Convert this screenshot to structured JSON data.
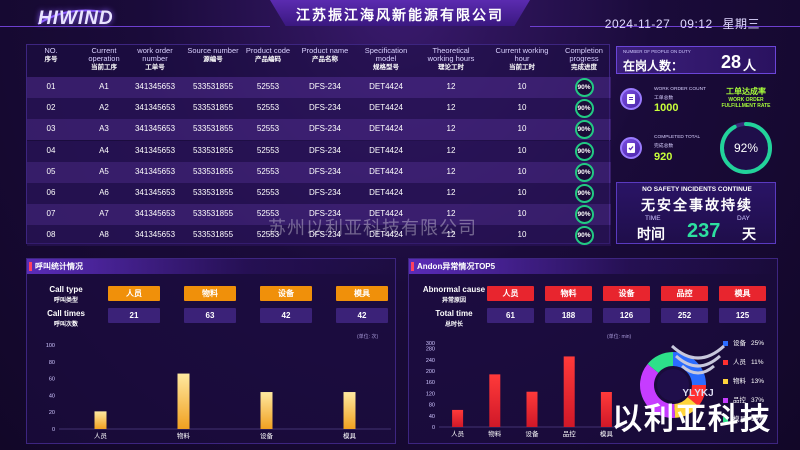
{
  "header": {
    "logo": "HIWIND",
    "company": "江苏振江海风新能源有限公司",
    "date": "2024-11-27",
    "time": "09:12",
    "weekday": "星期三"
  },
  "table": {
    "columns": [
      {
        "en": "NO.",
        "zh": "序号"
      },
      {
        "en": "Current operation",
        "zh": "当前工序"
      },
      {
        "en": "work order number",
        "zh": "工单号"
      },
      {
        "en": "Source number",
        "zh": "源编号"
      },
      {
        "en": "Product code",
        "zh": "产品编码"
      },
      {
        "en": "Product name",
        "zh": "产品名称"
      },
      {
        "en": "Specification model",
        "zh": "规格型号"
      },
      {
        "en": "Theoretical working hours",
        "zh": "理论工时"
      },
      {
        "en": "Current working hour",
        "zh": "当前工时"
      },
      {
        "en": "Completion progress",
        "zh": "完成进度"
      }
    ],
    "rows": [
      {
        "no": "01",
        "op": "A1",
        "wo": "341345653",
        "src": "533531855",
        "code": "52553",
        "name": "DFS-234",
        "spec": "DET4424",
        "theory": "12",
        "current": "10",
        "progress": "90%"
      },
      {
        "no": "02",
        "op": "A2",
        "wo": "341345653",
        "src": "533531855",
        "code": "52553",
        "name": "DFS-234",
        "spec": "DET4424",
        "theory": "12",
        "current": "10",
        "progress": "90%"
      },
      {
        "no": "03",
        "op": "A3",
        "wo": "341345653",
        "src": "533531855",
        "code": "52553",
        "name": "DFS-234",
        "spec": "DET4424",
        "theory": "12",
        "current": "10",
        "progress": "90%"
      },
      {
        "no": "04",
        "op": "A4",
        "wo": "341345653",
        "src": "533531855",
        "code": "52553",
        "name": "DFS-234",
        "spec": "DET4424",
        "theory": "12",
        "current": "10",
        "progress": "90%"
      },
      {
        "no": "05",
        "op": "A5",
        "wo": "341345653",
        "src": "533531855",
        "code": "52553",
        "name": "DFS-234",
        "spec": "DET4424",
        "theory": "12",
        "current": "10",
        "progress": "90%"
      },
      {
        "no": "06",
        "op": "A6",
        "wo": "341345653",
        "src": "533531855",
        "code": "52553",
        "name": "DFS-234",
        "spec": "DET4424",
        "theory": "12",
        "current": "10",
        "progress": "90%"
      },
      {
        "no": "07",
        "op": "A7",
        "wo": "341345653",
        "src": "533531855",
        "code": "52553",
        "name": "DFS-234",
        "spec": "DET4424",
        "theory": "12",
        "current": "10",
        "progress": "90%"
      },
      {
        "no": "08",
        "op": "A8",
        "wo": "341345653",
        "src": "533531855",
        "code": "52553",
        "name": "DFS-234",
        "spec": "DET4424",
        "theory": "12",
        "current": "10",
        "progress": "90%"
      }
    ]
  },
  "stats": {
    "duty_en": "NUMBER OF PEOPLE ON DUTY",
    "duty_zh": "在岗人数：",
    "duty_value": "28",
    "duty_unit": "人",
    "wo_count_en": "WORK ORDER COUNT",
    "wo_count_zh": "工单总数",
    "wo_count_value": "1000",
    "completed_en": "COMPLETED TOTAL",
    "completed_zh": "完成总数",
    "completed_value": "920",
    "rate_zh": "工单达成率",
    "rate_en": "WORK ORDER FULFILLMENT RATE",
    "rate_value": "92%",
    "rate_fraction": 0.92,
    "safety_en": "NO SAFETY INCIDENTS CONTINUE",
    "safety_zh": "无安全事故持续",
    "time_en": "TIME",
    "day_en": "DAY",
    "time_zh": "时间",
    "days_value": "237",
    "day_zh": "天"
  },
  "call_panel": {
    "title": "呼叫统计情况",
    "type_en": "Call type",
    "type_zh": "呼叫类型",
    "times_en": "Call times",
    "times_zh": "呼叫次数",
    "tag_color": "#f0900a",
    "categories": [
      "人员",
      "物料",
      "设备",
      "模具"
    ],
    "values": [
      "21",
      "63",
      "42",
      "42"
    ],
    "unit": "(单位: 次)"
  },
  "andon_panel": {
    "title": "Andon异常情况TOP5",
    "cause_en": "Abnormal cause",
    "cause_zh": "异常原因",
    "total_en": "Total time",
    "total_zh": "总时长",
    "tag_color": "#e8252e",
    "categories": [
      "人员",
      "物料",
      "设备",
      "品控",
      "模具"
    ],
    "values": [
      "61",
      "188",
      "126",
      "252",
      "125"
    ],
    "unit": "(单位: min)",
    "legend": [
      {
        "label": "设备",
        "pct": "25%",
        "color": "#2b6cff"
      },
      {
        "label": "人员",
        "pct": "11%",
        "color": "#ff3030"
      },
      {
        "label": "物料",
        "pct": "13%",
        "color": "#ffd43b"
      },
      {
        "label": "品控",
        "pct": "37%",
        "color": "#c63cff"
      },
      {
        "label": "模具",
        "pct": "14%",
        "color": "#2de08a"
      }
    ]
  },
  "chart_data": [
    {
      "type": "bar",
      "title": "",
      "categories": [
        "人员",
        "物料",
        "设备",
        "模具"
      ],
      "values": [
        21,
        66,
        44,
        44
      ],
      "ylim": [
        0,
        100
      ],
      "yticks": [
        0,
        20,
        40,
        60,
        80,
        100
      ],
      "xlabel": "",
      "ylabel": "",
      "unit": "(单位: 次)",
      "grid": false,
      "color": "#ffd86a"
    },
    {
      "type": "bar",
      "title": "",
      "categories": [
        "人员",
        "物料",
        "设备",
        "品控",
        "模具"
      ],
      "values": [
        61,
        188,
        126,
        252,
        125
      ],
      "ylim": [
        0,
        300
      ],
      "yticks": [
        0,
        40,
        80,
        120,
        160,
        200,
        240,
        280,
        300
      ],
      "xlabel": "",
      "ylabel": "",
      "unit": "(单位: min)",
      "grid": false,
      "color": "#ff2a2a"
    },
    {
      "type": "pie",
      "labels": [
        "设备",
        "人员",
        "物料",
        "品控",
        "模具"
      ],
      "values": [
        25,
        11,
        13,
        37,
        14
      ],
      "colors": [
        "#2b6cff",
        "#ff3030",
        "#ffd43b",
        "#c63cff",
        "#2de08a"
      ]
    }
  ],
  "watermark": "苏州以利亚科技有限公司",
  "brand": "以利亚科技",
  "brand_logo": "YLYKJ"
}
